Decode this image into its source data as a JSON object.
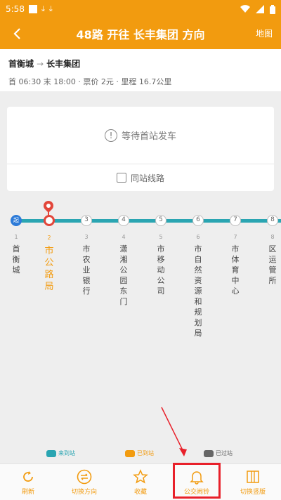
{
  "status_bar": {
    "time": "5:58"
  },
  "app_bar": {
    "title": "48路 开往 长丰集团 方向",
    "right_action": "地图",
    "back_icon": "back-arrow-icon"
  },
  "route_info": {
    "from": "首衡城",
    "to": "长丰集团",
    "arrow": "→",
    "details": "首 06:30 末 18:00 · 票价 2元 · 里程 16.7公里"
  },
  "wait_card": {
    "message": "等待首站发车",
    "same_station": "同站线路"
  },
  "stops": [
    {
      "badge": "起",
      "num": "1",
      "name": "首衡城"
    },
    {
      "badge": "",
      "num": "2",
      "name": "市公路局"
    },
    {
      "badge": "3",
      "num": "3",
      "name": "市农业银行"
    },
    {
      "badge": "4",
      "num": "4",
      "name": "潇湘公园东门"
    },
    {
      "badge": "5",
      "num": "5",
      "name": "市移动公司"
    },
    {
      "badge": "6",
      "num": "6",
      "name": "市自然资源和规划局"
    },
    {
      "badge": "7",
      "num": "7",
      "name": "市体育中心"
    },
    {
      "badge": "8",
      "num": "8",
      "name": "区运管所"
    }
  ],
  "current_stop_index": 1,
  "legend": {
    "arrived": {
      "label": "来到站",
      "color": "#2aa5b2"
    },
    "at_stop": {
      "label": "已到站",
      "color": "#f29b0f"
    },
    "passed": {
      "label": "已过站",
      "color": "#666666"
    }
  },
  "bottom_tabs": [
    {
      "label": "刷新",
      "icon": "refresh-icon"
    },
    {
      "label": "切换方向",
      "icon": "switch-direction-icon"
    },
    {
      "label": "收藏",
      "icon": "star-icon"
    },
    {
      "label": "公交闹铃",
      "icon": "bell-icon"
    },
    {
      "label": "切换竖版",
      "icon": "vertical-layout-icon"
    }
  ],
  "colors": {
    "accent": "#f29b0f",
    "line": "#2aa5b2",
    "current": "#e2463a",
    "highlight": "#e8202a"
  }
}
